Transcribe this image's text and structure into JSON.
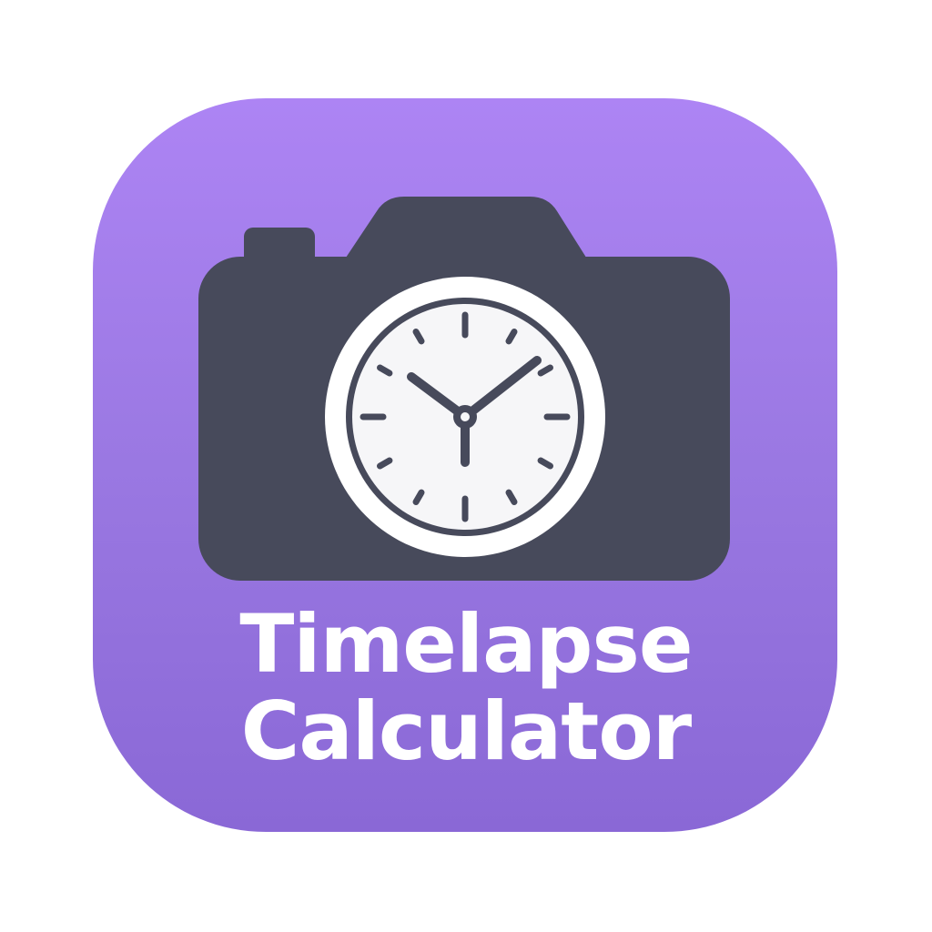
{
  "app_icon": {
    "title_line_1": "Timelapse",
    "title_line_2": "Calculator",
    "icons": [
      "camera-icon",
      "clock-icon"
    ],
    "colors": {
      "background_top": "#ad84f4",
      "background_bottom": "#8a68d6",
      "camera_body": "#474a5b",
      "clock_face": "#f6f6f8",
      "text": "#ffffff"
    }
  }
}
